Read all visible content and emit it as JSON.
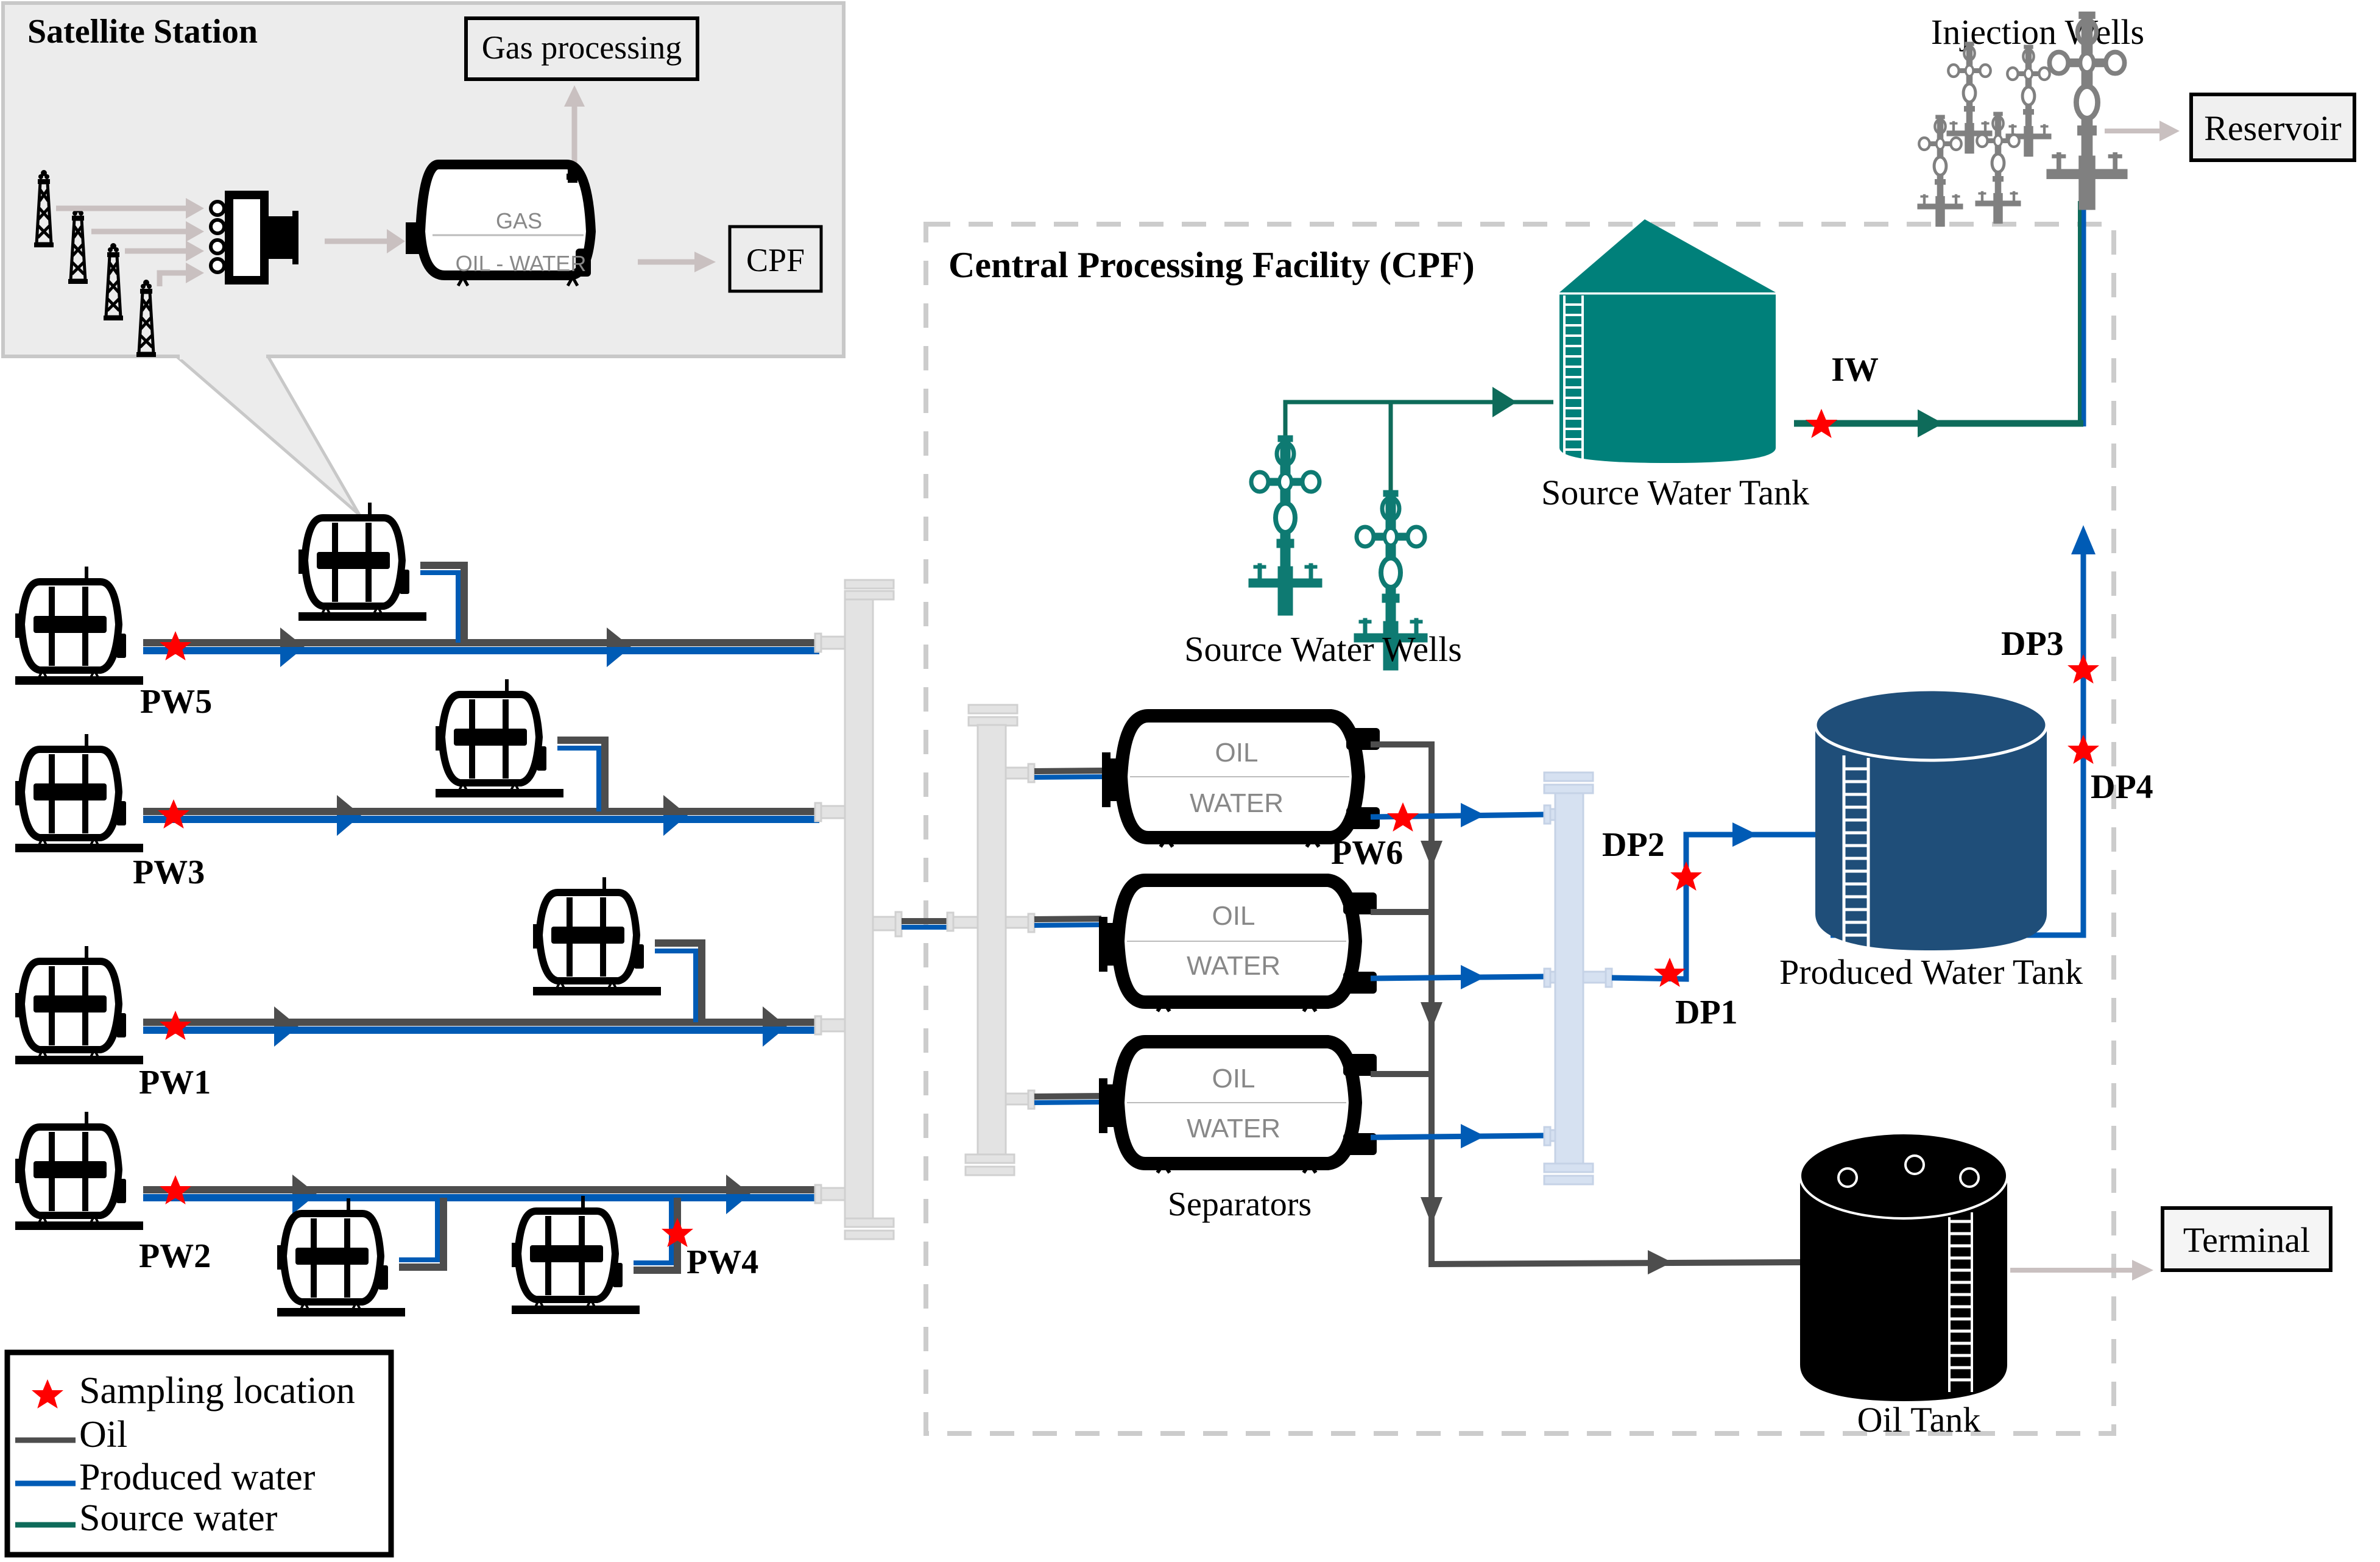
{
  "colors": {
    "oil": "#4d4d4d",
    "produced_water": "#005bb5",
    "source_water": "#0e6b5a",
    "source_water_tank": "#00807a",
    "produced_water_tank": "#1f4e79",
    "oil_tank": "#000000",
    "sampling_star": "#ff0000",
    "manifold": "#e3e3e3",
    "blue_manifold": "#d6e1f1",
    "injection_well": "#808080",
    "flow_arrow_gray": "#c9c0c0",
    "satellite_bg": "#ececec"
  },
  "satellite_station": {
    "title": "Satellite Station",
    "gas_processing_label": "Gas processing",
    "cpf_label": "CPF",
    "separator_gas_label": "GAS",
    "separator_liquid_label": "OIL - WATER"
  },
  "cpf": {
    "title": "Central Processing Facility (CPF)",
    "source_water_tank_label": "Source Water Tank",
    "source_water_wells_label": "Source Water Wells",
    "separators_label": "Separators",
    "separator_oil_label": "OIL",
    "separator_water_label": "WATER",
    "produced_water_tank_label": "Produced Water Tank",
    "oil_tank_label": "Oil Tank"
  },
  "injection": {
    "wells_label": "Injection Wells",
    "reservoir_label": "Reservoir"
  },
  "terminal_label": "Terminal",
  "sampling_points": {
    "pw1": "PW1",
    "pw2": "PW2",
    "pw3": "PW3",
    "pw4": "PW4",
    "pw5": "PW5",
    "pw6": "PW6",
    "dp1": "DP1",
    "dp2": "DP2",
    "dp3": "DP3",
    "dp4": "DP4",
    "iw": "IW"
  },
  "legend": {
    "items": [
      {
        "label": "Sampling location",
        "symbol": "star"
      },
      {
        "label": "Oil",
        "symbol": "line-oil"
      },
      {
        "label": "Produced water",
        "symbol": "line-produced-water"
      },
      {
        "label": "Source water",
        "symbol": "line-source-water"
      }
    ]
  }
}
